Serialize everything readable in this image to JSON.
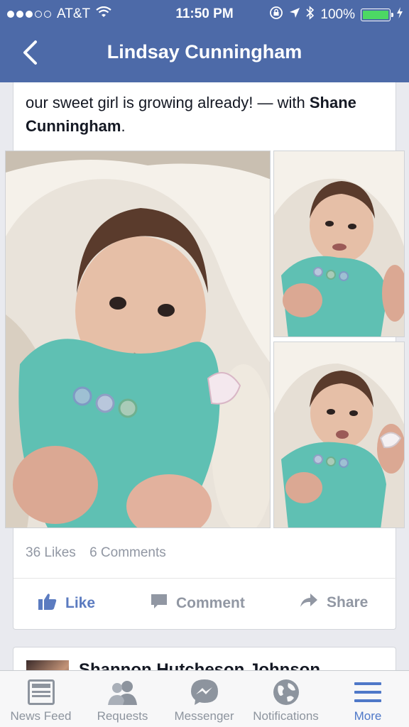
{
  "status_bar": {
    "carrier": "AT&T",
    "signal_bars": 3,
    "time": "11:50 PM",
    "battery": "100%",
    "battery_level": 1.0
  },
  "nav": {
    "back_icon": "chevron-left-icon",
    "title": "Lindsay Cunningham"
  },
  "post": {
    "caption_text": "our sweet girl is growing already! — with",
    "tagged_name": "Shane Cunningham",
    "caption_end": ".",
    "photos_count": 3,
    "likes": "36 Likes",
    "comments": "6 Comments",
    "actions": {
      "like": "Like",
      "comment": "Comment",
      "share": "Share"
    }
  },
  "next_post": {
    "author": "Shannon Hutcheson Johnson"
  },
  "tabbar": {
    "items": [
      {
        "label": "News Feed",
        "icon": "news-feed-icon"
      },
      {
        "label": "Requests",
        "icon": "requests-icon"
      },
      {
        "label": "Messenger",
        "icon": "messenger-icon"
      },
      {
        "label": "Notifications",
        "icon": "globe-icon"
      },
      {
        "label": "More",
        "icon": "menu-icon"
      }
    ],
    "active": "More"
  },
  "colors": {
    "brand_blue": "#4d6aa8",
    "active_tab": "#4f78c8",
    "battery_green": "#4cd964"
  }
}
